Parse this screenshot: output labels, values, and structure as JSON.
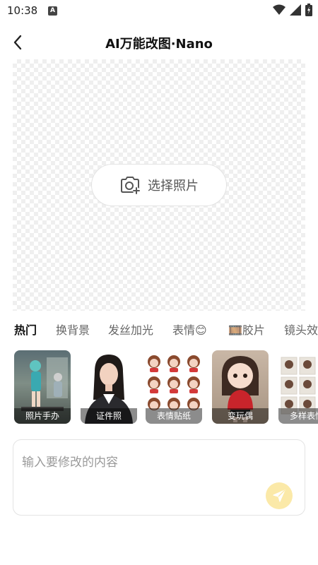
{
  "status": {
    "time": "10:38",
    "notification_badge": "A"
  },
  "header": {
    "title": "AI万能改图·Nano"
  },
  "canvas": {
    "select_photo_label": "选择照片"
  },
  "tabs": [
    {
      "label": "热门",
      "active": true
    },
    {
      "label": "换背景",
      "active": false
    },
    {
      "label": "发丝加光",
      "active": false
    },
    {
      "label": "表情😊",
      "active": false
    },
    {
      "label": "🎞️胶片",
      "active": false
    },
    {
      "label": "镜头效",
      "active": false
    }
  ],
  "cards": [
    {
      "label": "照片手办"
    },
    {
      "label": "证件照"
    },
    {
      "label": "表情贴纸"
    },
    {
      "label": "变玩偶"
    },
    {
      "label": "多样表情"
    }
  ],
  "prompt": {
    "placeholder": "输入要修改的内容",
    "value": ""
  },
  "colors": {
    "accent": "#fbe9a8",
    "send_icon": "#ffffff",
    "active_tab": "#111111"
  }
}
